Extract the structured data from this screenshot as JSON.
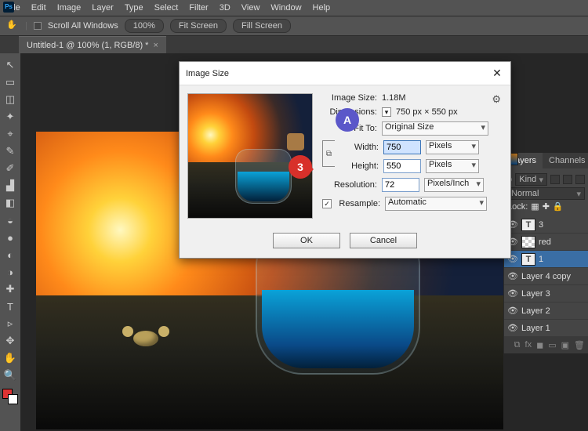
{
  "menubar": [
    "File",
    "Edit",
    "Image",
    "Layer",
    "Type",
    "Select",
    "Filter",
    "3D",
    "View",
    "Window",
    "Help"
  ],
  "optbar": {
    "scroll_label": "Scroll All Windows",
    "zoom": "100%",
    "fit": "Fit Screen",
    "fill": "Fill Screen"
  },
  "doctab": {
    "label": "Untitled-1 @ 100% (1, RGB/8) *"
  },
  "tools": [
    "↖",
    "▭",
    "◫",
    "✦",
    "⌖",
    "✎",
    "✐",
    "▟",
    "◧",
    "◒",
    "●",
    "◐",
    "◑",
    "✚",
    "◉",
    "T",
    "▹",
    "✥",
    "✋",
    "🔍"
  ],
  "layers_panel": {
    "tabs": [
      "Layers",
      "Channels"
    ],
    "kind_label": "Kind",
    "blend": "Normal",
    "lock_label": "Lock:",
    "layers": [
      {
        "vis": true,
        "type": "T",
        "name": "3"
      },
      {
        "vis": true,
        "type": "chk",
        "name": "red"
      },
      {
        "vis": true,
        "type": "T",
        "name": "1",
        "selected": true
      },
      {
        "vis": true,
        "type": "sky",
        "name": "Layer 4 copy"
      },
      {
        "vis": true,
        "type": "sky",
        "name": "Layer 3"
      },
      {
        "vis": true,
        "type": "sky",
        "name": "Layer 2"
      },
      {
        "vis": true,
        "type": "sky",
        "name": "Layer 1"
      }
    ]
  },
  "dialog": {
    "title": "Image Size",
    "imgsize_label": "Image Size:",
    "imgsize_val": "1.18M",
    "dim_label": "Dimensions:",
    "dim_val": "750 px × 550 px",
    "fitto_label": "Fit To:",
    "fitto_val": "Original Size",
    "width_label": "Width:",
    "width_val": "750",
    "width_unit": "Pixels",
    "height_label": "Height:",
    "height_val": "550",
    "height_unit": "Pixels",
    "res_label": "Resolution:",
    "res_val": "72",
    "res_unit": "Pixels/Inch",
    "resample_label": "Resample:",
    "resample_val": "Automatic",
    "ok": "OK",
    "cancel": "Cancel"
  },
  "callouts": {
    "a": "A",
    "n": "3"
  }
}
